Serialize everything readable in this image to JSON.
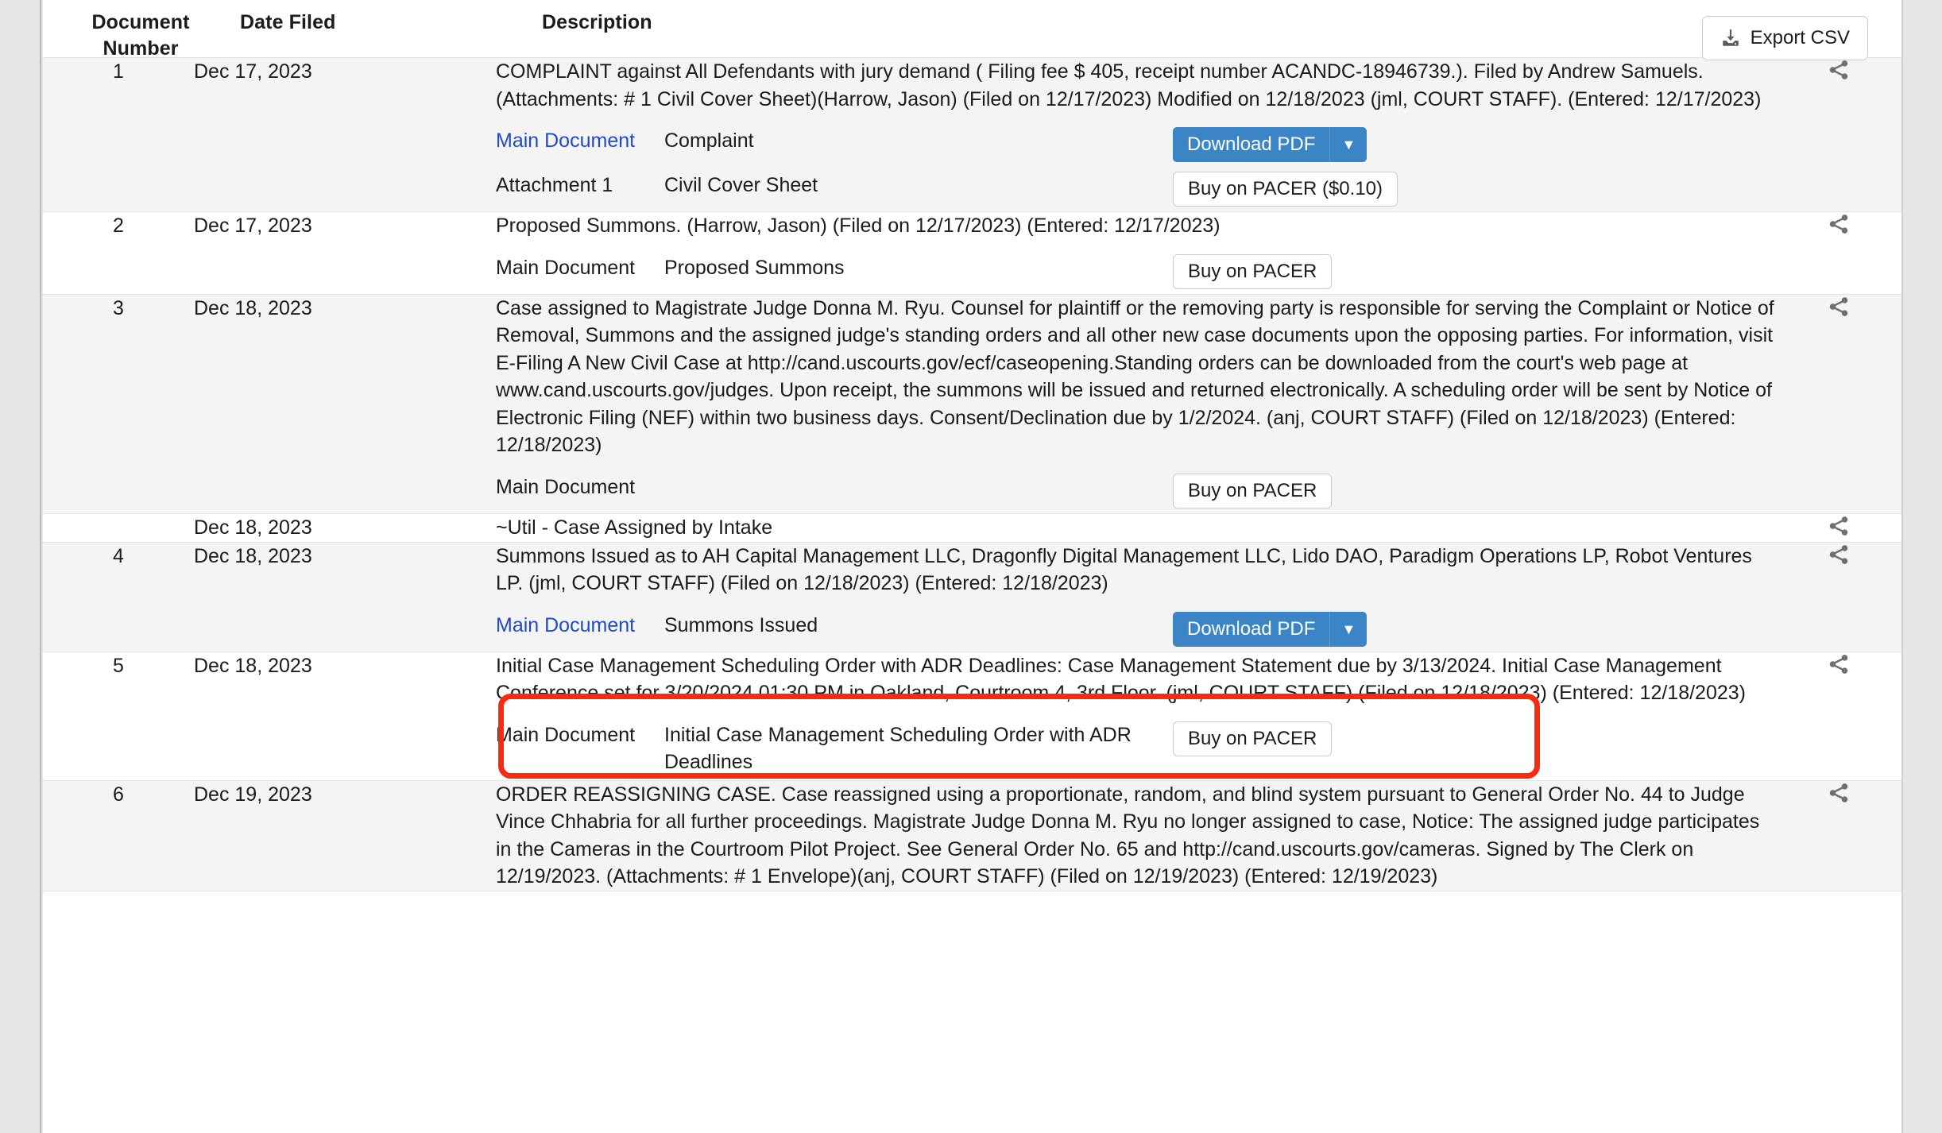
{
  "table": {
    "columns": {
      "document_number": "Document Number",
      "document_number_line1": "Document",
      "document_number_line2": "Number",
      "date_filed": "Date Filed",
      "description": "Description"
    },
    "export_button": "Export CSV",
    "export_icon": "download-tray-icon",
    "share_icon": "share-icon",
    "caret_icon": "chevron-down-icon"
  },
  "colors": {
    "link": "#1f49c9",
    "primary_button": "#3b85c6",
    "annotation_highlight": "#fa2a10",
    "row_shaded": "#f4f4f4",
    "row_plain": "#ffffff"
  },
  "rows": [
    {
      "number": "1",
      "date": "Dec 17, 2023",
      "description": "COMPLAINT against All Defendants with jury demand ( Filing fee $ 405, receipt number ACANDC-18946739.). Filed by Andrew Samuels. (Attachments: # 1 Civil Cover Sheet)(Harrow, Jason) (Filed on 12/17/2023) Modified on 12/18/2023 (jml, COURT STAFF). (Entered: 12/17/2023)",
      "documents": [
        {
          "label": "Main Document",
          "is_link": true,
          "title": "Complaint",
          "action": "Download PDF",
          "action_type": "download"
        },
        {
          "label": "Attachment 1",
          "is_link": false,
          "title": "Civil Cover Sheet",
          "action": "Buy on PACER ($0.10)",
          "action_type": "pacer"
        }
      ]
    },
    {
      "number": "2",
      "date": "Dec 17, 2023",
      "description": "Proposed Summons. (Harrow, Jason) (Filed on 12/17/2023) (Entered: 12/17/2023)",
      "documents": [
        {
          "label": "Main Document",
          "is_link": false,
          "title": "Proposed Summons",
          "action": "Buy on PACER",
          "action_type": "pacer"
        }
      ]
    },
    {
      "number": "3",
      "date": "Dec 18, 2023",
      "description": "Case assigned to Magistrate Judge Donna M. Ryu. Counsel for plaintiff or the removing party is responsible for serving the Complaint or Notice of Removal, Summons and the assigned judge's standing orders and all other new case documents upon the opposing parties. For information, visit E-Filing A New Civil Case at http://cand.uscourts.gov/ecf/caseopening.Standing orders can be downloaded from the court's web page at www.cand.uscourts.gov/judges. Upon receipt, the summons will be issued and returned electronically. A scheduling order will be sent by Notice of Electronic Filing (NEF) within two business days. Consent/Declination due by 1/2/2024. (anj, COURT STAFF) (Filed on 12/18/2023) (Entered: 12/18/2023)",
      "documents": [
        {
          "label": "Main Document",
          "is_link": false,
          "title": "",
          "action": "Buy on PACER",
          "action_type": "pacer"
        }
      ]
    },
    {
      "number": "",
      "date": "Dec 18, 2023",
      "description": "~Util - Case Assigned by Intake",
      "documents": []
    },
    {
      "number": "4",
      "date": "Dec 18, 2023",
      "description": "Summons Issued as to AH Capital Management LLC, Dragonfly Digital Management LLC, Lido DAO, Paradigm Operations LP, Robot Ventures LP. (jml, COURT STAFF) (Filed on 12/18/2023) (Entered: 12/18/2023)",
      "highlighted": true,
      "documents": [
        {
          "label": "Main Document",
          "is_link": true,
          "title": "Summons Issued",
          "action": "Download PDF",
          "action_type": "download"
        }
      ]
    },
    {
      "number": "5",
      "date": "Dec 18, 2023",
      "description": "Initial Case Management Scheduling Order with ADR Deadlines: Case Management Statement due by 3/13/2024. Initial Case Management Conference set for 3/20/2024 01:30 PM in Oakland, Courtroom 4, 3rd Floor. (jml, COURT STAFF) (Filed on 12/18/2023) (Entered: 12/18/2023)",
      "documents": [
        {
          "label": "Main Document",
          "is_link": false,
          "title": "Initial Case Management Scheduling Order with ADR Deadlines",
          "action": "Buy on PACER",
          "action_type": "pacer"
        }
      ]
    },
    {
      "number": "6",
      "date": "Dec 19, 2023",
      "description": "ORDER REASSIGNING CASE. Case reassigned using a proportionate, random, and blind system pursuant to General Order No. 44 to Judge Vince Chhabria for all further proceedings. Magistrate Judge Donna M. Ryu no longer assigned to case, Notice: The assigned judge participates in the Cameras in the Courtroom Pilot Project. See General Order No. 65 and http://cand.uscourts.gov/cameras. Signed by The Clerk on 12/19/2023. (Attachments: # 1 Envelope)(anj, COURT STAFF) (Filed on 12/19/2023) (Entered: 12/19/2023)",
      "documents": []
    }
  ]
}
